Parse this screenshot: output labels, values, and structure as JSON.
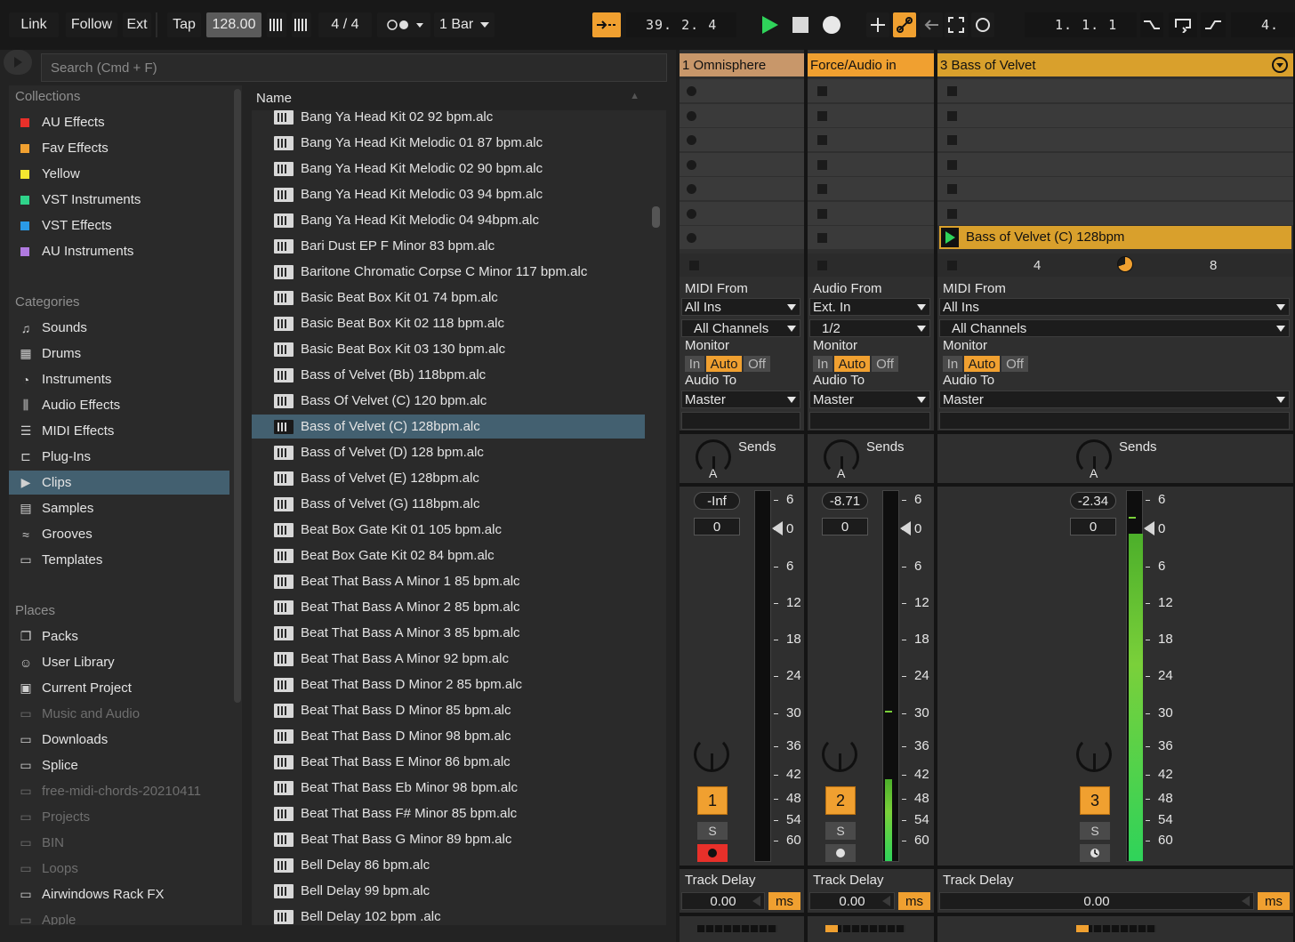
{
  "transport": {
    "link": "Link",
    "follow": "Follow",
    "ext": "Ext",
    "tap": "Tap",
    "tempo": "128.00",
    "signature": "4 / 4",
    "quantize": "1 Bar",
    "position": "39.  2.  4",
    "loop_start": "1.  1.  1",
    "loop_len": "4."
  },
  "browser": {
    "search_placeholder": "Search (Cmd + F)",
    "sections": {
      "collections": "Collections",
      "categories": "Categories",
      "places": "Places"
    },
    "collections": [
      {
        "label": "AU Effects",
        "color": "#e8302a"
      },
      {
        "label": "Fav Effects",
        "color": "#f0a030"
      },
      {
        "label": "Yellow",
        "color": "#f5e830"
      },
      {
        "label": "VST Instruments",
        "color": "#2fd38a"
      },
      {
        "label": "VST Effects",
        "color": "#2a9be8"
      },
      {
        "label": "AU Instruments",
        "color": "#b07ae0"
      }
    ],
    "categories": [
      {
        "label": "Sounds",
        "icon": "note-icon"
      },
      {
        "label": "Drums",
        "icon": "grid-icon"
      },
      {
        "label": "Instruments",
        "icon": "clock-icon"
      },
      {
        "label": "Audio Effects",
        "icon": "waveform-icon"
      },
      {
        "label": "MIDI Effects",
        "icon": "midi-icon"
      },
      {
        "label": "Plug-Ins",
        "icon": "plug-icon"
      },
      {
        "label": "Clips",
        "icon": "clip-icon"
      },
      {
        "label": "Samples",
        "icon": "samples-icon"
      },
      {
        "label": "Grooves",
        "icon": "groove-icon"
      },
      {
        "label": "Templates",
        "icon": "template-icon"
      }
    ],
    "places": [
      {
        "label": "Packs",
        "icon": "packs-icon"
      },
      {
        "label": "User Library",
        "icon": "user-icon"
      },
      {
        "label": "Current Project",
        "icon": "project-icon"
      },
      {
        "label": "Music and Audio",
        "icon": "folder-icon"
      },
      {
        "label": "Downloads",
        "icon": "folder-icon"
      },
      {
        "label": "Splice",
        "icon": "folder-icon"
      },
      {
        "label": "free-midi-chords-20210411",
        "icon": "folder-icon"
      },
      {
        "label": "Projects",
        "icon": "folder-icon"
      },
      {
        "label": "BIN",
        "icon": "folder-icon"
      },
      {
        "label": "Loops",
        "icon": "folder-icon"
      },
      {
        "label": "Airwindows Rack FX",
        "icon": "folder-icon"
      },
      {
        "label": "Apple",
        "icon": "folder-icon"
      }
    ],
    "column_name": "Name",
    "files": [
      "Bang Ya Head Kit 02 92 bpm.alc",
      "Bang Ya Head Kit Melodic 01 87 bpm.alc",
      "Bang Ya Head Kit Melodic 02 90 bpm.alc",
      "Bang Ya Head Kit Melodic 03 94 bpm.alc",
      "Bang Ya Head Kit Melodic 04 94bpm.alc",
      "Bari Dust EP F Minor 83 bpm.alc",
      "Baritone Chromatic Corpse C Minor 117 bpm.alc",
      "Basic Beat Box Kit 01 74 bpm.alc",
      "Basic Beat Box Kit 02 118 bpm.alc",
      "Basic Beat Box Kit 03 130 bpm.alc",
      "Bass of Velvet (Bb) 118bpm.alc",
      "Bass Of Velvet (C) 120 bpm.alc",
      "Bass of Velvet (C) 128bpm.alc",
      "Bass of Velvet (D) 128 bpm.alc",
      "Bass of Velvet (E) 128bpm.alc",
      "Bass of Velvet (G) 118bpm.alc",
      "Beat Box Gate Kit 01 105 bpm.alc",
      "Beat Box Gate Kit 02 84 bpm.alc",
      "Beat That Bass A Minor 1 85 bpm.alc",
      "Beat That Bass A Minor 2 85 bpm.alc",
      "Beat That Bass A Minor 3 85 bpm.alc",
      "Beat That Bass A Minor 92 bpm.alc",
      "Beat That Bass D Minor 2 85 bpm.alc",
      "Beat That Bass D Minor 85 bpm.alc",
      "Beat That Bass D Minor 98 bpm.alc",
      "Beat That Bass E Minor 86 bpm.alc",
      "Beat That Bass Eb Minor 98 bpm.alc",
      "Beat That Bass F# Minor 85 bpm.alc",
      "Beat That Bass G Minor 89 bpm.alc",
      "Bell Delay 86 bpm.alc",
      "Bell Delay 99 bpm.alc",
      "Bell Delay 102 bpm .alc"
    ]
  },
  "tracks": [
    {
      "title": "1 Omnisphere",
      "color": "#c8976a",
      "io_label": "MIDI From",
      "io_source": "All Ins",
      "io_channel": "All Channels",
      "monitor": "Monitor",
      "mon_in": "In",
      "mon_auto": "Auto",
      "mon_off": "Off",
      "out_label": "Audio To",
      "out_target": "Master",
      "sends": "Sends",
      "send_knob": "A",
      "volume": "-Inf",
      "pan": "0",
      "number": "1",
      "solo": "S",
      "delay_label": "Track Delay",
      "delay_value": "0.00",
      "delay_unit": "ms"
    },
    {
      "title": "Force/Audio in",
      "color": "#f0a030",
      "io_label": "Audio From",
      "io_source": "Ext. In",
      "io_channel": "1/2",
      "monitor": "Monitor",
      "mon_in": "In",
      "mon_auto": "Auto",
      "mon_off": "Off",
      "out_label": "Audio To",
      "out_target": "Master",
      "sends": "Sends",
      "send_knob": "A",
      "volume": "-8.71",
      "pan": "0",
      "number": "2",
      "solo": "S",
      "delay_label": "Track Delay",
      "delay_value": "0.00",
      "delay_unit": "ms"
    },
    {
      "title": "3 Bass of Velvet",
      "color": "#d9a02c",
      "io_label": "MIDI From",
      "io_source": "All Ins",
      "io_channel": "All Channels",
      "monitor": "Monitor",
      "mon_in": "In",
      "mon_auto": "Auto",
      "mon_off": "Off",
      "out_label": "Audio To",
      "out_target": "Master",
      "sends": "Sends",
      "send_knob": "A",
      "volume": "-2.34",
      "pan": "0",
      "number": "3",
      "solo": "S",
      "delay_label": "Track Delay",
      "delay_value": "0.00",
      "delay_unit": "ms",
      "clip": "Bass of Velvet (C) 128bpm",
      "clip_pos_a": "4",
      "clip_pos_b": "8"
    }
  ],
  "meter_scale": [
    "6",
    "0",
    "6",
    "12",
    "18",
    "24",
    "30",
    "36",
    "42",
    "48",
    "54",
    "60"
  ]
}
